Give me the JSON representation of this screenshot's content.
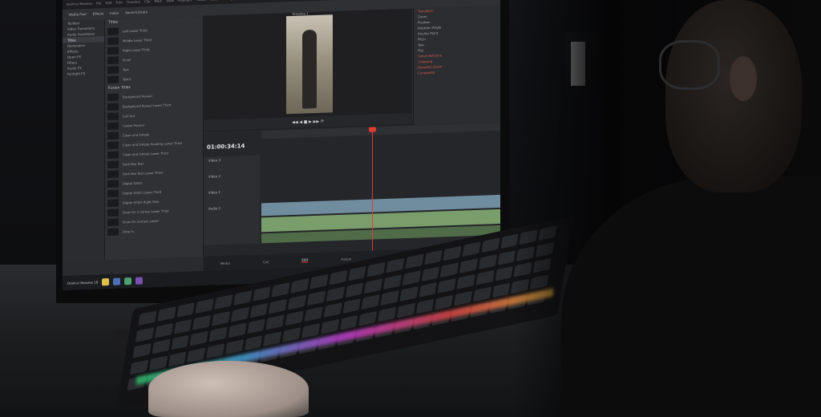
{
  "scene": {
    "description_tags": [
      "monitor",
      "video-editor",
      "keyboard",
      "person"
    ]
  },
  "editor": {
    "menu_items": [
      "DaVinci Resolve",
      "File",
      "Edit",
      "Trim",
      "Timeline",
      "Clip",
      "Mark",
      "View",
      "Playback",
      "Fusion",
      "Color",
      "Fairlight",
      "Workspace",
      "Help"
    ],
    "toolbar_items": [
      "Media Pool",
      "Effects",
      "Index",
      "Sound Library"
    ],
    "project_title": "Rising Dad",
    "timeline_name": "Timeline 1",
    "library": [
      "Toolbox",
      "Video Transitions",
      "Audio Transitions",
      "Titles",
      "Generators",
      "Effects",
      "Open FX",
      "Filters",
      "Audio FX",
      "Fairlight FX"
    ],
    "library_selected_index": 3,
    "titles_header": "Titles",
    "titles_list": [
      "Left Lower Third",
      "Middle Lower Third",
      "Right Lower Third",
      "Scroll",
      "Text",
      "Text+"
    ],
    "fusion_header": "Fusion Titles",
    "fusion_list": [
      "Background Reveal",
      "Background Reveal Lower Third",
      "Call Out",
      "Center Reveal",
      "Clean and Simple",
      "Clean and Simple Heading Lower Third",
      "Clean and Simple Lower Third",
      "Dark Box Text",
      "Dark Box Text Lower Third",
      "Digital Glitch",
      "Digital Glitch Lower Third",
      "Digital Glitch Right Side",
      "Draw On 1 Corner Lower Third",
      "Draw On Corners Lower",
      "Drop In"
    ],
    "timecode": "01:00:34:14",
    "tracks": [
      "Video 3",
      "Video 2",
      "Video 1",
      "Audio 1"
    ],
    "inspector": [
      "Transform",
      "Zoom",
      "Position",
      "Rotation Angle",
      "Anchor Point",
      "Pitch",
      "Yaw",
      "Flip",
      "Smart Reframe",
      "Cropping",
      "Dynamic Zoom",
      "Composite"
    ],
    "pages": [
      "Media",
      "Cut",
      "Edit",
      "Fusion",
      "Color",
      "Fairlight",
      "Deliver"
    ],
    "active_page_index": 2,
    "taskbar_app": "DaVinci Resolve 18"
  },
  "colors": {
    "playhead": "#e23b32",
    "clip_video": "#6f8d9e",
    "clip_audio": "#7a9d6c"
  }
}
